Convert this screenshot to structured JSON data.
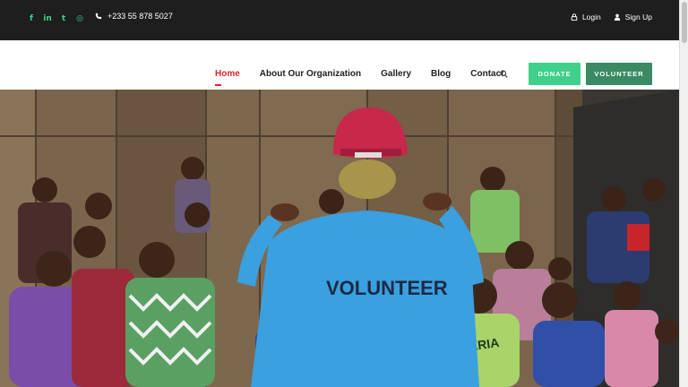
{
  "topbar": {
    "social": [
      {
        "icon": "facebook-icon",
        "glyph": "f"
      },
      {
        "icon": "linkedin-icon",
        "glyph": "in"
      },
      {
        "icon": "twitter-icon",
        "glyph": "t"
      },
      {
        "icon": "instagram-icon",
        "glyph": "◎"
      }
    ],
    "phone": "+233 55 878 5027",
    "login_label": "Login",
    "signup_label": "Sign Up"
  },
  "nav": {
    "items": [
      {
        "label": "Home",
        "active": true
      },
      {
        "label": "About Our Organization",
        "active": false
      },
      {
        "label": "Gallery",
        "active": false
      },
      {
        "label": "Blog",
        "active": false
      },
      {
        "label": "Contact",
        "active": false
      }
    ],
    "donate_label": "DONATE",
    "volunteer_label": "VOLUNTEER"
  },
  "hero": {
    "shirt_text": "VOLUNTEER",
    "jersey_text": "NIGERIA"
  },
  "colors": {
    "topbar_bg": "#1e1e1e",
    "accent_green": "#3fd08a",
    "dark_green": "#3a8a64",
    "active_red": "#d9262b",
    "shirt_blue": "#3aa0e0",
    "cap_red": "#c8284a"
  }
}
